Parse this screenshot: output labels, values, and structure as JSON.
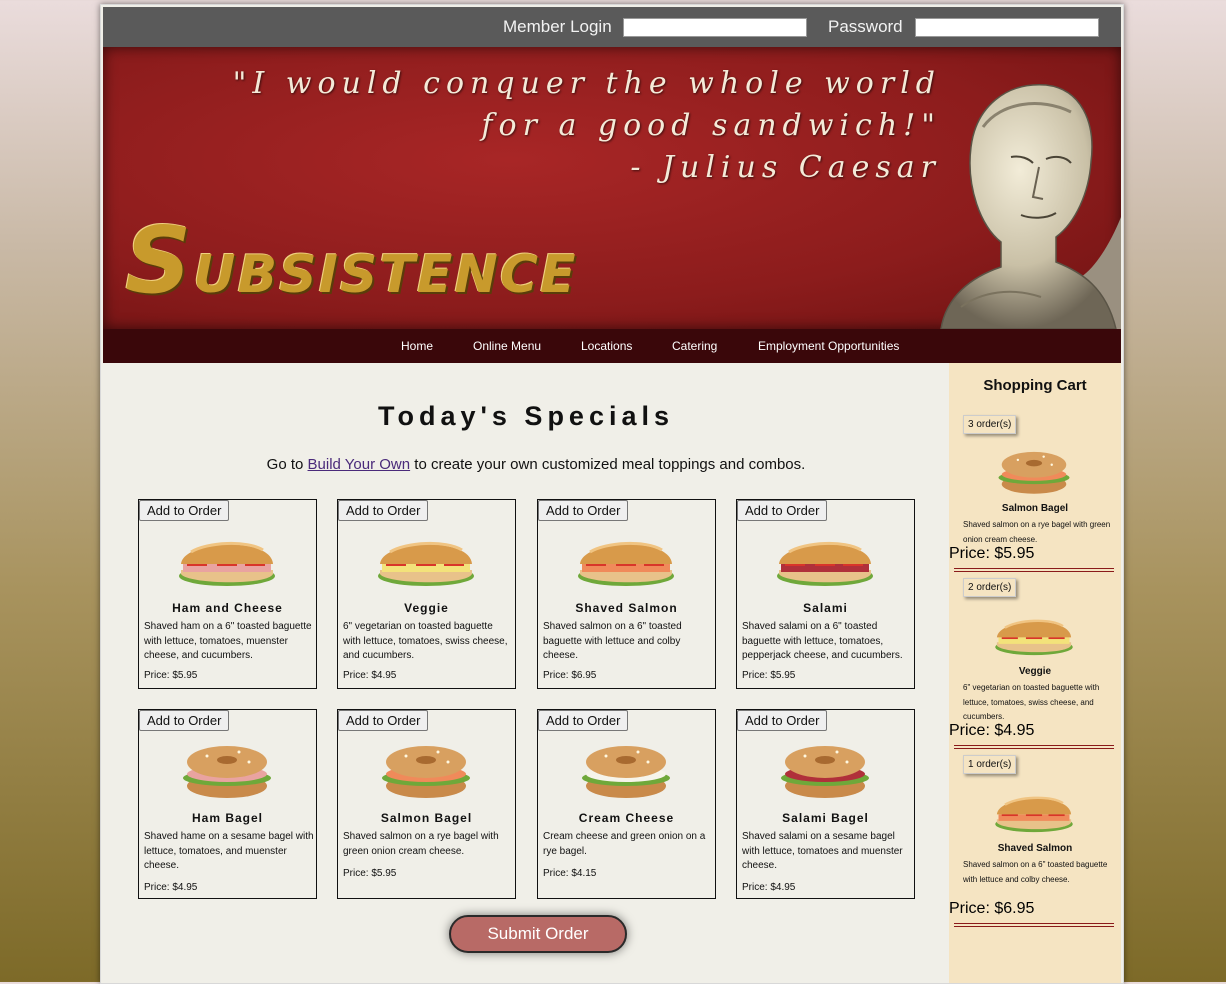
{
  "header": {
    "member_login_label": "Member Login",
    "password_label": "Password",
    "member_login_value": "",
    "password_value": ""
  },
  "banner": {
    "quote_line1": "\"I would conquer the whole world",
    "quote_line2": "for a good sandwich!\"",
    "quote_line3": "- Julius Caesar",
    "logo_first": "S",
    "logo_rest": "UBSISTENCE"
  },
  "nav": {
    "items": [
      "Home",
      "Online Menu",
      "Locations",
      "Catering",
      "Employment Opportunities"
    ]
  },
  "main": {
    "title": "Today's Specials",
    "intro_before": "Go to ",
    "intro_link": "Build Your Own",
    "intro_after": " to create your own customized meal toppings and combos.",
    "add_label": "Add to Order",
    "submit_label": "Submit Order",
    "items": [
      {
        "name": "Ham and Cheese",
        "desc": "Shaved ham on a 6\" toasted baguette with lettuce, tomatoes, muenster cheese, and cucumbers.",
        "price": "Price: $5.95",
        "kind": "sub-ham"
      },
      {
        "name": "Veggie",
        "desc": "6\" vegetarian on toasted baguette with lettuce, tomatoes, swiss cheese, and cucumbers.",
        "price": "Price: $4.95",
        "kind": "sub-veggie"
      },
      {
        "name": "Shaved Salmon",
        "desc": "Shaved salmon on a 6\" toasted baguette with lettuce and colby cheese.",
        "price": "Price: $6.95",
        "kind": "sub-salmon"
      },
      {
        "name": "Salami",
        "desc": "Shaved salami on a 6\" toasted baguette with lettuce, tomatoes, pepperjack cheese, and cucumbers.",
        "price": "Price: $5.95",
        "kind": "sub-salami"
      },
      {
        "name": "Ham Bagel",
        "desc": "Shaved hame on a sesame bagel with lettuce, tomatoes, and muenster cheese.",
        "price": "Price: $4.95",
        "kind": "bagel-ham"
      },
      {
        "name": "Salmon Bagel",
        "desc": "Shaved salmon on a rye bagel with green onion cream cheese.",
        "price": "Price: $5.95",
        "kind": "bagel-salmon"
      },
      {
        "name": "Cream Cheese",
        "desc": "Cream cheese and green onion on a rye bagel.",
        "price": "Price: $4.15",
        "kind": "bagel-cream"
      },
      {
        "name": "Salami Bagel",
        "desc": "Shaved salami on a sesame bagel with lettuce, tomatoes and muenster cheese.",
        "price": "Price: $4.95",
        "kind": "bagel-salami"
      }
    ]
  },
  "cart": {
    "title": "Shopping Cart",
    "items": [
      {
        "qty": "3 order(s)",
        "name": "Salmon Bagel",
        "desc": "Shaved salmon on a rye bagel with green onion cream cheese.",
        "price": "Price: $5.95",
        "kind": "bagel-salmon"
      },
      {
        "qty": "2 order(s)",
        "name": "Veggie",
        "desc": "6\" vegetarian on toasted baguette with lettuce, tomatoes, swiss cheese, and cucumbers.",
        "price": "Price: $4.95",
        "kind": "sub-veggie"
      },
      {
        "qty": "1 order(s)",
        "name": "Shaved Salmon",
        "desc": "Shaved salmon on a 6\" toasted baguette with lettuce and colby cheese.",
        "price": "Price: $6.95",
        "kind": "sub-salmon"
      }
    ]
  },
  "colors": {
    "banner_red": "#8c1c1c",
    "nav_bg": "#3a070a",
    "topbar_bg": "#5a5a5a",
    "cart_bg": "#f5e4c2",
    "submit_bg": "#b86a66"
  }
}
